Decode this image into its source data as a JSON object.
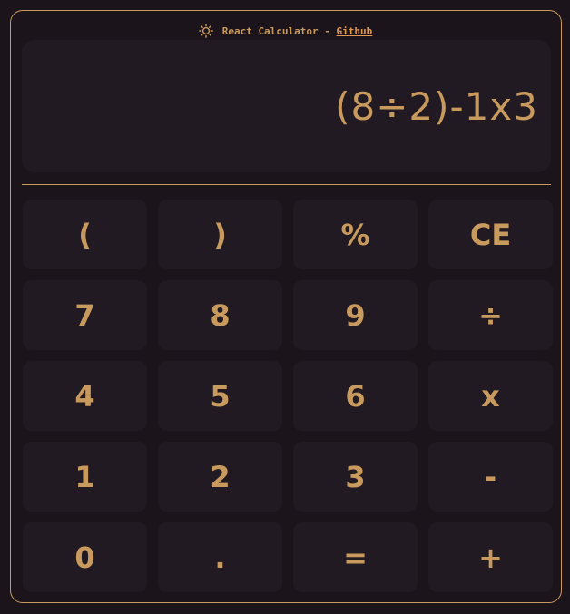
{
  "header": {
    "title": "React Calculator",
    "separator": " - ",
    "link_label": "Github",
    "theme_icon": "sun-icon"
  },
  "display": {
    "expression": "(8÷2)-1x3"
  },
  "keys": [
    {
      "label": "(",
      "name": "key-open-paren"
    },
    {
      "label": ")",
      "name": "key-close-paren"
    },
    {
      "label": "%",
      "name": "key-percent"
    },
    {
      "label": "CE",
      "name": "key-clear-entry"
    },
    {
      "label": "7",
      "name": "key-7"
    },
    {
      "label": "8",
      "name": "key-8"
    },
    {
      "label": "9",
      "name": "key-9"
    },
    {
      "label": "÷",
      "name": "key-divide"
    },
    {
      "label": "4",
      "name": "key-4"
    },
    {
      "label": "5",
      "name": "key-5"
    },
    {
      "label": "6",
      "name": "key-6"
    },
    {
      "label": "x",
      "name": "key-multiply"
    },
    {
      "label": "1",
      "name": "key-1"
    },
    {
      "label": "2",
      "name": "key-2"
    },
    {
      "label": "3",
      "name": "key-3"
    },
    {
      "label": "-",
      "name": "key-subtract"
    },
    {
      "label": "0",
      "name": "key-0"
    },
    {
      "label": ".",
      "name": "key-decimal"
    },
    {
      "label": "=",
      "name": "key-equals"
    },
    {
      "label": "+",
      "name": "key-add"
    }
  ],
  "colors": {
    "background": "#1c141b",
    "panel": "#221a22",
    "accent": "#c89a5e",
    "link": "#e09a52"
  }
}
